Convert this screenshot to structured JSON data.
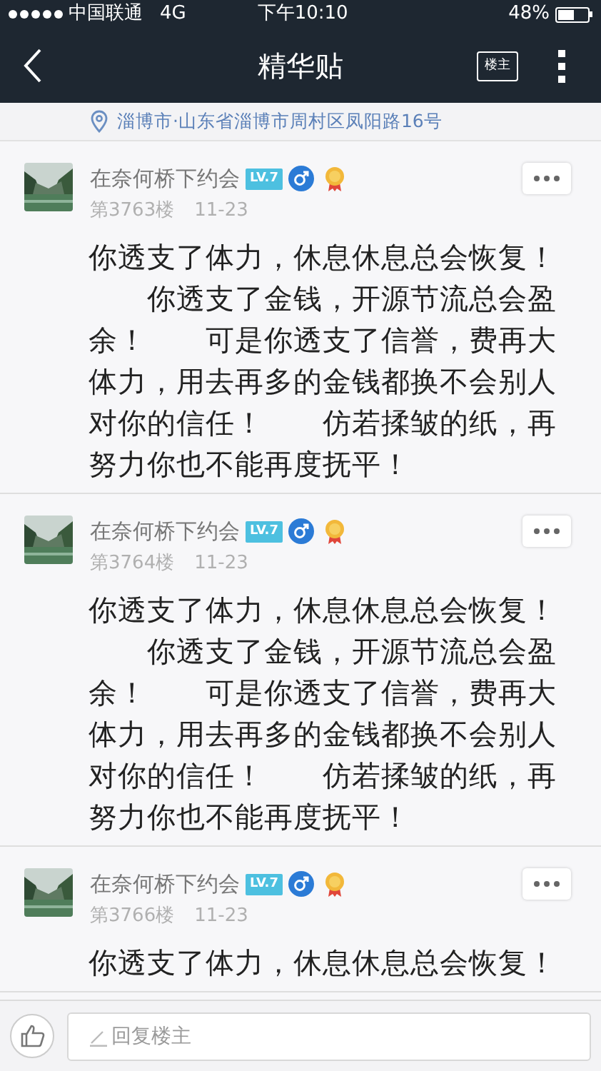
{
  "status_bar": {
    "carrier": "中国联通",
    "network": "4G",
    "time": "下午10:10",
    "battery": "48%"
  },
  "nav": {
    "title": "精华贴",
    "author_only_button": "楼主"
  },
  "location": "淄博市·山东省淄博市周村区凤阳路16号",
  "posts": [
    {
      "author": "在奈何桥下约会",
      "level_badge": "LV.7",
      "floor": "第3763楼",
      "date": "11-23",
      "body": [
        "你透支了体力，休息休息总会恢复！",
        "　　你透支了金钱，开源节流总会盈",
        "余！　　可是你透支了信誉，费再大",
        "体力，用去再多的金钱都换不会别人",
        "对你的信任！　　仿若揉皱的纸，再",
        "努力你也不能再度抚平！"
      ]
    },
    {
      "author": "在奈何桥下约会",
      "level_badge": "LV.7",
      "floor": "第3764楼",
      "date": "11-23",
      "body": [
        "你透支了体力，休息休息总会恢复！",
        "　　你透支了金钱，开源节流总会盈",
        "余！　　可是你透支了信誉，费再大",
        "体力，用去再多的金钱都换不会别人",
        "对你的信任！　　仿若揉皱的纸，再",
        "努力你也不能再度抚平！"
      ]
    },
    {
      "author": "在奈何桥下约会",
      "level_badge": "LV.7",
      "floor": "第3766楼",
      "date": "11-23",
      "body": [
        "你透支了体力，休息休息总会恢复！"
      ]
    }
  ],
  "reply_bar": {
    "placeholder": "回复楼主"
  }
}
